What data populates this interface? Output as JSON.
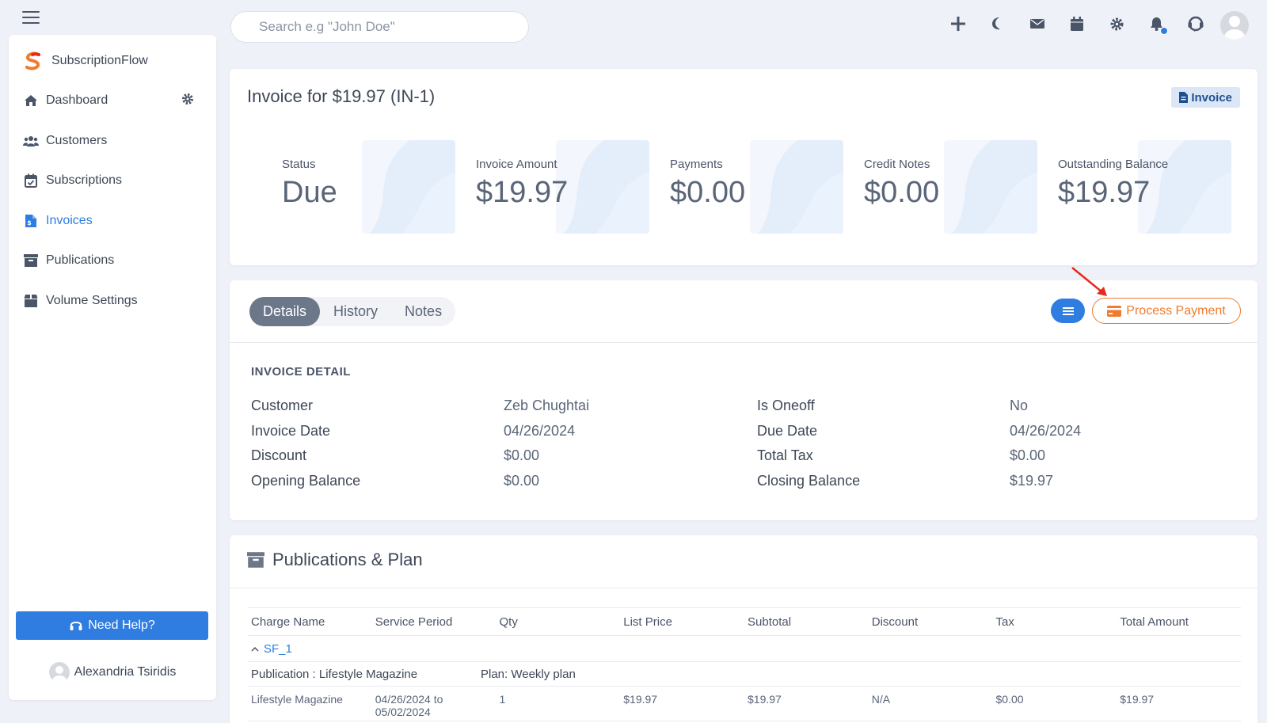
{
  "search": {
    "placeholder": "Search e.g \"John Doe\""
  },
  "brand": {
    "name": "SubscriptionFlow"
  },
  "sidebar": {
    "items": [
      {
        "label": "Dashboard",
        "icon": "home-icon"
      },
      {
        "label": "Customers",
        "icon": "users-icon"
      },
      {
        "label": "Subscriptions",
        "icon": "calendar-check-icon"
      },
      {
        "label": "Invoices",
        "icon": "invoice-icon",
        "active": true
      },
      {
        "label": "Publications",
        "icon": "archive-icon"
      },
      {
        "label": "Volume Settings",
        "icon": "box-icon"
      }
    ],
    "help_label": "Need Help?",
    "user_name": "Alexandria Tsiridis"
  },
  "colors": {
    "accent": "#2f7de1",
    "orange": "#f07a2e",
    "annotation": "#e8291c"
  },
  "invoice": {
    "title": "Invoice for $19.97 (IN-1)",
    "badge": "Invoice",
    "stats": [
      {
        "label": "Status",
        "value": "Due"
      },
      {
        "label": "Invoice Amount",
        "value": "$19.97"
      },
      {
        "label": "Payments",
        "value": "$0.00"
      },
      {
        "label": "Credit Notes",
        "value": "$0.00"
      },
      {
        "label": "Outstanding Balance",
        "value": "$19.97"
      }
    ]
  },
  "details": {
    "tabs": [
      "Details",
      "History",
      "Notes"
    ],
    "process_payment": "Process Payment",
    "section_title": "INVOICE DETAIL",
    "rows": [
      {
        "l1": "Customer",
        "v1": "Zeb Chughtai",
        "l2": "Is Oneoff",
        "v2": "No"
      },
      {
        "l1": "Invoice Date",
        "v1": "04/26/2024",
        "l2": "Due Date",
        "v2": "04/26/2024"
      },
      {
        "l1": "Discount",
        "v1": "$0.00",
        "l2": "Total Tax",
        "v2": "$0.00"
      },
      {
        "l1": "Opening Balance",
        "v1": "$0.00",
        "l2": "Closing Balance",
        "v2": "$19.97"
      }
    ]
  },
  "publications": {
    "title": "Publications & Plan",
    "columns": [
      "Charge Name",
      "Service Period",
      "Qty",
      "List Price",
      "Subtotal",
      "Discount",
      "Tax",
      "Total Amount"
    ],
    "group": "SF_1",
    "publication_label": "Publication : Lifestyle Magazine",
    "plan_label": "Plan: Weekly plan",
    "row": [
      "Lifestyle Magazine",
      "04/26/2024 to 05/02/2024",
      "1",
      "$19.97",
      "$19.97",
      "N/A",
      "$0.00",
      "$19.97"
    ]
  }
}
